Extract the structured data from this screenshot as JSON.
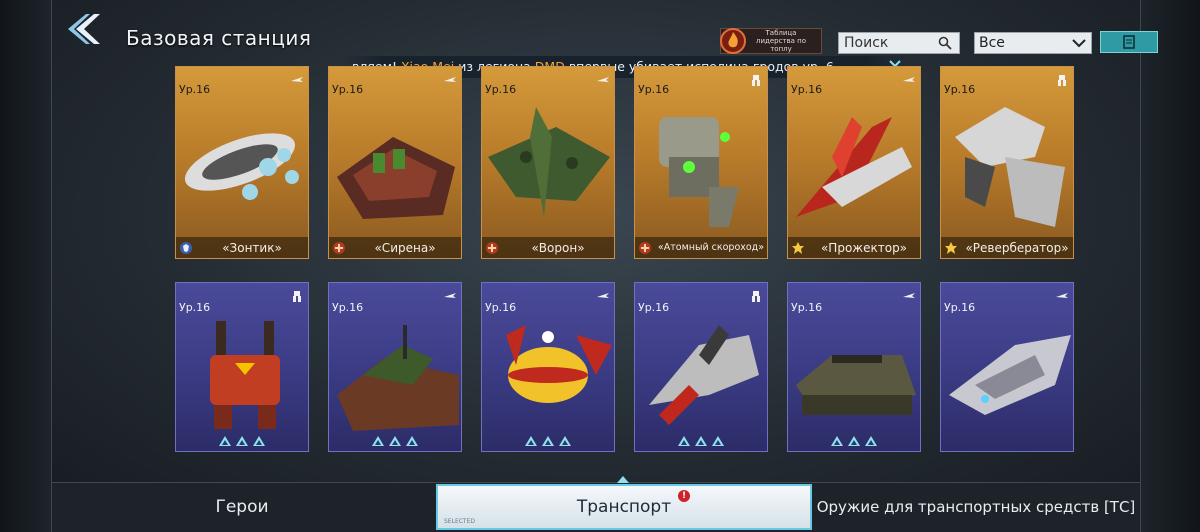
{
  "header": {
    "title": "Базовая станция",
    "leaderboard_label": "Таблица лидерства по топлу",
    "search_placeholder": "Поиск",
    "filter_value": "Все"
  },
  "ticker": {
    "prefix": "вляем! ",
    "player": "Xiao Mei",
    "mid": " из легиона ",
    "legion": "DMD",
    "suffix": " впервые убивает исполина гродов ур. 6."
  },
  "colors": {
    "gold_card": "#c98a32",
    "purple_card": "#42428e",
    "accent": "#66c9e5",
    "highlight": "#f0a43a"
  },
  "cards_row1": [
    {
      "level": "Ур.16",
      "name": "«Зонтик»",
      "name_icon": "shield-icon",
      "tag_icon": "aircraft-icon"
    },
    {
      "level": "Ур.16",
      "name": "«Сирена»",
      "name_icon": "assault-icon",
      "tag_icon": "aircraft-icon"
    },
    {
      "level": "Ур.16",
      "name": "«Ворон»",
      "name_icon": "assault-icon",
      "tag_icon": "aircraft-icon"
    },
    {
      "level": "Ур.16",
      "name": "«Атомный скороход»",
      "name_icon": "assault-icon",
      "tag_icon": "mech-icon"
    },
    {
      "level": "Ур.16",
      "name": "«Прожектор»",
      "name_icon": "star-icon",
      "tag_icon": "aircraft-icon"
    },
    {
      "level": "Ур.16",
      "name": "«Ревербератор»",
      "name_icon": "star-icon",
      "tag_icon": "mech-icon"
    }
  ],
  "cards_row2": [
    {
      "level": "Ур.16",
      "tag_icon": "mech-icon",
      "rank": 3
    },
    {
      "level": "Ур.16",
      "tag_icon": "aircraft-icon",
      "rank": 3
    },
    {
      "level": "Ур.16",
      "tag_icon": "aircraft-icon",
      "rank": 3
    },
    {
      "level": "Ур.16",
      "tag_icon": "mech-icon",
      "rank": 3
    },
    {
      "level": "Ур.16",
      "tag_icon": "aircraft-icon",
      "rank": 3
    },
    {
      "level": "Ур.16",
      "tag_icon": "aircraft-icon",
      "rank": 0
    }
  ],
  "tabs": [
    {
      "label": "Герои"
    },
    {
      "label": "Транспорт",
      "badge": "!",
      "sub": "SELECTED"
    },
    {
      "label": "Оружие для транспортных средств [ТС]"
    }
  ]
}
